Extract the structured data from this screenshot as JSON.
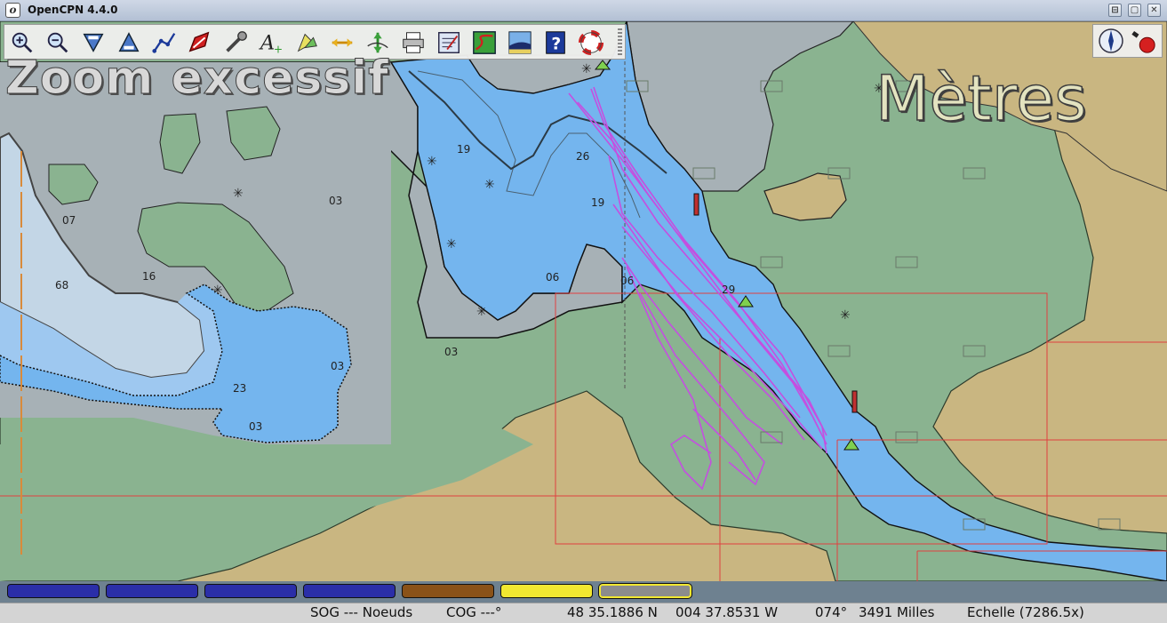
{
  "window": {
    "title": "OpenCPN 4.4.0",
    "controls": [
      "minimize",
      "maximize",
      "close"
    ],
    "close_glyph": "✕",
    "maximize_glyph": "▢",
    "minimize_glyph": "⊟"
  },
  "toolbar": {
    "items": [
      {
        "name": "zoom-in-icon",
        "tooltip": "Zoom In"
      },
      {
        "name": "zoom-out-icon",
        "tooltip": "Zoom Out"
      },
      {
        "name": "scale-down-icon",
        "tooltip": "Shift to Larger Scale Chart"
      },
      {
        "name": "scale-up-icon",
        "tooltip": "Shift to Smaller Scale Chart"
      },
      {
        "name": "route-icon",
        "tooltip": "Create Route"
      },
      {
        "name": "follow-boat-icon",
        "tooltip": "Auto Follow"
      },
      {
        "name": "options-icon",
        "tooltip": "Options"
      },
      {
        "name": "text-icon",
        "tooltip": "Show ENC text"
      },
      {
        "name": "tide-icon",
        "tooltip": "Show Tides"
      },
      {
        "name": "current-icon",
        "tooltip": "Show Currents"
      },
      {
        "name": "profile-icon",
        "tooltip": "Show Depth"
      },
      {
        "name": "print-icon",
        "tooltip": "Print Chart"
      },
      {
        "name": "route-manager-icon",
        "tooltip": "Route & Mark Manager"
      },
      {
        "name": "track-icon",
        "tooltip": "Enable Tracking"
      },
      {
        "name": "color-scheme-icon",
        "tooltip": "Change Color Scheme"
      },
      {
        "name": "help-icon",
        "tooltip": "About OpenCPN"
      },
      {
        "name": "mob-icon",
        "tooltip": "Drop MOB Marker"
      }
    ]
  },
  "toolbar2": {
    "items": [
      {
        "name": "compass-icon"
      },
      {
        "name": "gps-status-icon"
      }
    ]
  },
  "overlays": {
    "zoom_text": "Zoom excessif",
    "units_text": "Mètres"
  },
  "colors": {
    "land": "#c9b681",
    "drying": "#8ab390",
    "deep_water": "#c3d6e6",
    "shallow": "#74b5ee",
    "medium": "#9ec8f0",
    "intertidal": "#a7b1b6",
    "track": "#c44fe0",
    "chart_outline": "#e04040",
    "piano_blue": "#2b2ea8",
    "piano_brown": "#8a5218",
    "piano_yellow": "#f2e830",
    "piano_gray": "#8c8c8c"
  },
  "soundings": [
    "07",
    "16",
    "68",
    "19",
    "26",
    "19",
    "03",
    "06",
    "06",
    "29",
    "23",
    "03",
    "03",
    "03"
  ],
  "piano": [
    {
      "color": "blue",
      "label": ""
    },
    {
      "color": "blue",
      "label": ""
    },
    {
      "color": "blue",
      "label": ""
    },
    {
      "color": "blue",
      "label": ""
    },
    {
      "color": "brown",
      "label": ""
    },
    {
      "color": "yellow",
      "label": ""
    },
    {
      "color": "gray",
      "label": ""
    }
  ],
  "status": {
    "sog": "SOG --- Noeuds",
    "cog": "COG ---°",
    "lat": "48 35.1886 N",
    "lon": "004 37.8531 W",
    "bearing": "074°",
    "distance": "3491 Milles",
    "scale": "Echelle (7286.5x)"
  }
}
